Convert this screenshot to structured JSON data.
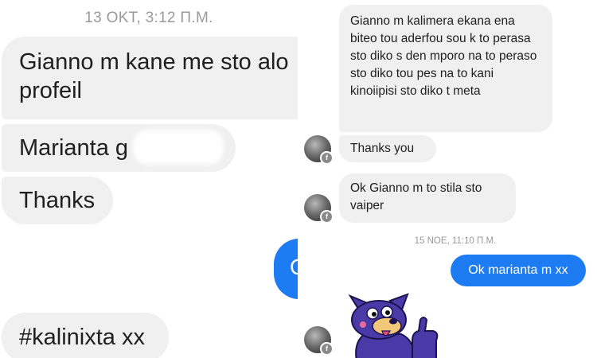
{
  "left_panel": {
    "timestamp": "13 OKT, 3:12 Π.Μ.",
    "messages": [
      "Gianno m kane me sto alo profeil",
      "Marianta g",
      "Thanks",
      "#kalinixta xx"
    ],
    "partial_sent_glyph": "O"
  },
  "right_panel": {
    "received": [
      "Gianno m kalimera ekana ena biteo tou aderfou sou k to perasa sto diko s den mporo na to peraso sto diko tou pes na to kani kinoiipisi sto diko t meta",
      "Thanks you",
      "Ok Gianno m to stila sto vaiper"
    ],
    "timestamp": "15 NOE, 11:10 Π.Μ.",
    "sent": "Ok marianta m xx"
  },
  "colors": {
    "sent_bubble": "#1e7cf3",
    "received_bubble": "#f0f0f0",
    "timestamp_text": "#9a9a9a",
    "sticker_dog": "#4a3aa8"
  },
  "icons": {
    "avatar_badge": "messenger-badge-icon",
    "sticker": "dog-thumbs-up-sticker"
  }
}
